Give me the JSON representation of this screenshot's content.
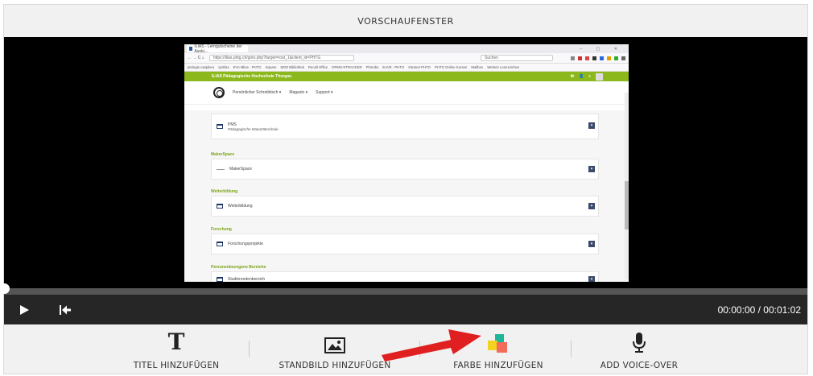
{
  "header": {
    "title": "VORSCHAUFENSTER"
  },
  "preview": {
    "browser": {
      "tab_title": "ILIAS - Lerngutscheine der Ausbi...",
      "window_controls": "– ▢ ✕",
      "url": "https://ilias.phtg.ch/goto.php?target=root_1&client_id=PHTG",
      "search_placeholder": "Suchen",
      "bookmarks": [
        "ptologie.caspikeu",
        "vp2ilas",
        "EVA Mlive - PHTG",
        "Square",
        "MOZ Bibliothek",
        "Recall Office",
        "OPMS-STRACKER",
        "Photobs",
        "EAVE - PHTG",
        "Intranet PHTG",
        "PHTG Online Kursen",
        "Mailbox",
        "Weitere Lesezeichen"
      ]
    },
    "site": {
      "org_name": "ILIAS Pädagogische Hochschule Thurgau",
      "nav": [
        "Persönlicher Schreibtisch ▾",
        "Magazin ▾",
        "Support ▾"
      ],
      "items": [
        {
          "title": "PMS",
          "subtitle": "Pädagogische Maturitätsschule"
        },
        {
          "section": "MakerSpace",
          "title": "MakerSpace"
        },
        {
          "section": "Weiterbildung",
          "title": "Weiterbildung"
        },
        {
          "section": "Forschung",
          "title": "Forschungsprojekte"
        },
        {
          "section": "Personenbezogene Bereiche",
          "title": "Studierendenbereich"
        }
      ],
      "expander_glyph": "▾"
    }
  },
  "player": {
    "progress": 0,
    "time": "00:00:00 / 00:01:02",
    "play_icon": "play-icon",
    "rewind_icon": "skip-to-start-icon"
  },
  "toolbar": {
    "items": [
      {
        "label": "TITEL HINZUFÜGEN",
        "icon": "text-icon"
      },
      {
        "label": "STANDBILD HINZUFÜGEN",
        "icon": "image-icon"
      },
      {
        "label": "FARBE HINZUFÜGEN",
        "icon": "color-squares-icon"
      },
      {
        "label": "ADD VOICE-OVER",
        "icon": "microphone-icon"
      }
    ],
    "title_glyph": "T"
  },
  "colors": {
    "accent_green": "#8cb81b",
    "arrow_red": "#e02020",
    "stage_black": "#000000"
  }
}
